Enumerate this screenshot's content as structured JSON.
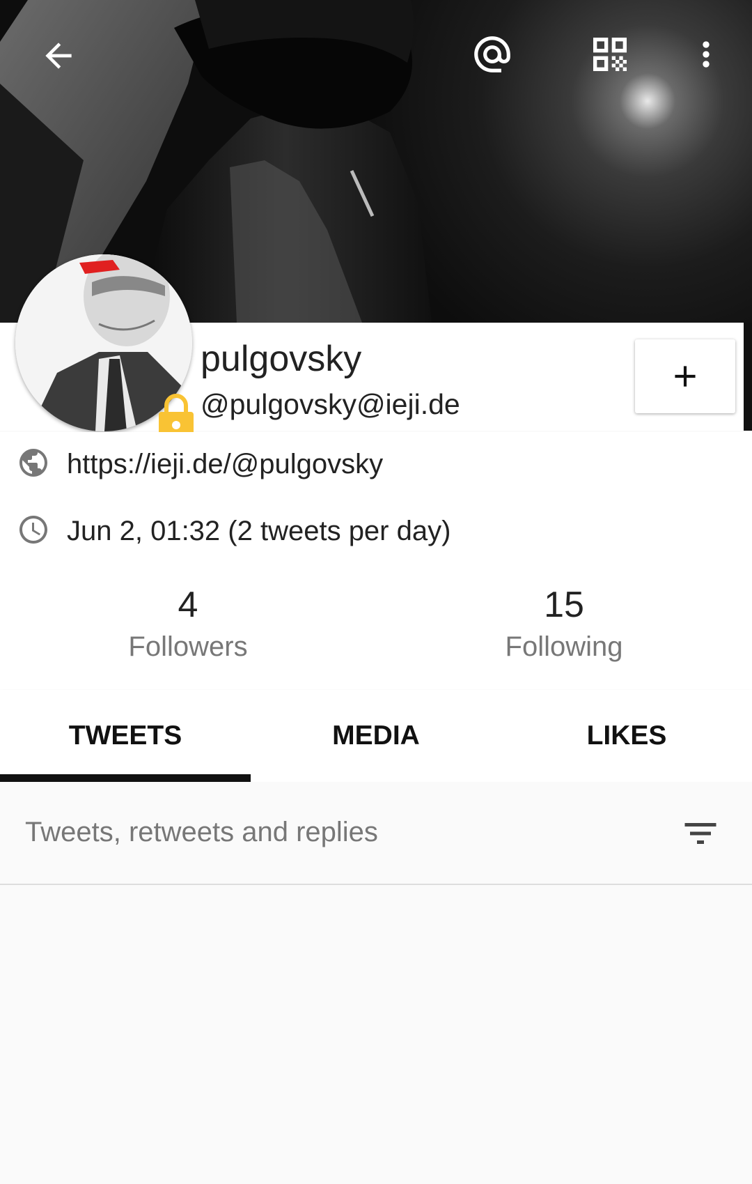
{
  "toolbar": {
    "back_icon": "arrow-back-icon",
    "mention_icon": "at-sign-icon",
    "qr_icon": "qr-code-icon",
    "more_icon": "more-vert-icon"
  },
  "profile": {
    "display_name": "pulgovsky",
    "handle": "@pulgovsky@ieji.de",
    "locked": true,
    "lock_color": "#f9c334",
    "follow_button_symbol": "+"
  },
  "info": {
    "website": "https://ieji.de/@pulgovsky",
    "joined": "Jun 2, 01:32 (2 tweets per day)"
  },
  "stats": {
    "followers_count": "4",
    "followers_label": "Followers",
    "following_count": "15",
    "following_label": "Following"
  },
  "tabs": {
    "items": [
      {
        "label": "TWEETS"
      },
      {
        "label": "MEDIA"
      },
      {
        "label": "LIKES"
      }
    ],
    "active_index": 0
  },
  "filter": {
    "label": "Tweets, retweets and replies"
  }
}
